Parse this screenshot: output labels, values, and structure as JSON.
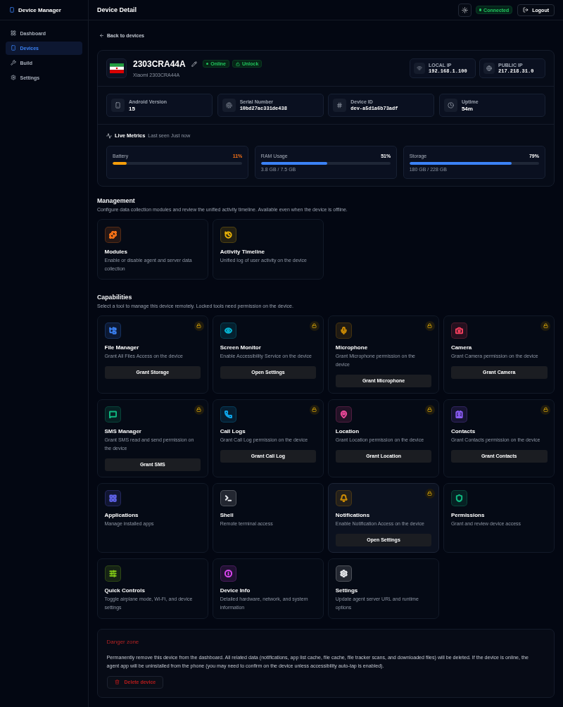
{
  "sidebar": {
    "title": "Device Manager",
    "items": [
      {
        "label": "Dashboard",
        "selected": false
      },
      {
        "label": "Devices",
        "selected": true
      },
      {
        "label": "Build",
        "selected": false
      },
      {
        "label": "Settings",
        "selected": false
      }
    ]
  },
  "header": {
    "title": "Device Detail",
    "status": "Connected",
    "logout": "Logout"
  },
  "back_link": "Back to devices",
  "device": {
    "name": "2303CRA44A",
    "model": "Xiaomi 2303CRA44A",
    "badges": [
      {
        "label": "Online",
        "kind": "dot"
      },
      {
        "label": "Unlock",
        "kind": "lock"
      }
    ],
    "network": [
      {
        "label": "LOCAL IP",
        "value": "192.168.1.100"
      },
      {
        "label": "PUBLIC IP",
        "value": "217.218.31.0"
      }
    ],
    "info": [
      {
        "label": "Android Version",
        "value": "15",
        "kind": "text"
      },
      {
        "label": "Serial Number",
        "value": "10bd27ac331de438",
        "kind": "code"
      },
      {
        "label": "Device ID",
        "value": "dev-a5d1a6b73adf",
        "kind": "code"
      },
      {
        "label": "Uptime",
        "value": "54m",
        "kind": "text"
      }
    ],
    "metrics_title": "Live Metrics",
    "last_seen": "Last seen Just now",
    "metrics": [
      {
        "label": "Battery",
        "reading": "11%",
        "level": 0.11,
        "warning": true
      },
      {
        "label": "RAM Usage",
        "reading": "51%",
        "level": 0.51,
        "detail": "3.8 GB / 7.5 GB",
        "warning": false
      },
      {
        "label": "Storage",
        "reading": "79%",
        "level": 0.79,
        "detail": "180 GB / 228 GB",
        "warning": false
      }
    ]
  },
  "management": {
    "title": "Management",
    "description": "Configure data collection modules and review the unified activity timeline. Available even when the device is offline.",
    "cards": [
      {
        "title": "Modules",
        "description": "Enable or disable agent and server data collection",
        "color": "#f97316"
      },
      {
        "title": "Activity Timeline",
        "description": "Unified log of user activity on the device",
        "color": "#eab308"
      }
    ]
  },
  "capabilities": {
    "title": "Capabilities",
    "description": "Select a tool to manage this device remotely. Locked tools need permission on the device.",
    "cards": [
      {
        "title": "File Manager",
        "description": "Grant All Files Access on the device",
        "action": "Grant Storage",
        "locked": true,
        "highlighted": false,
        "color": "#3b82f6"
      },
      {
        "title": "Screen Monitor",
        "description": "Enable Accessibility Service on the device",
        "action": "Open Settings",
        "locked": true,
        "highlighted": false,
        "color": "#06b6d4"
      },
      {
        "title": "Microphone",
        "description": "Grant Microphone permission on the device",
        "action": "Grant Microphone",
        "locked": true,
        "highlighted": false,
        "color": "#ca8a04"
      },
      {
        "title": "Camera",
        "description": "Grant Camera permission on the device",
        "action": "Grant Camera",
        "locked": true,
        "highlighted": false,
        "color": "#f43f5e"
      },
      {
        "title": "SMS Manager",
        "description": "Grant SMS read and send permission on the device",
        "action": "Grant SMS",
        "locked": true,
        "highlighted": false,
        "color": "#10b981"
      },
      {
        "title": "Call Logs",
        "description": "Grant Call Log permission on the device",
        "action": "Grant Call Log",
        "locked": true,
        "highlighted": false,
        "color": "#0ea5e9"
      },
      {
        "title": "Location",
        "description": "Grant Location permission on the device",
        "action": "Grant Location",
        "locked": true,
        "highlighted": false,
        "color": "#ec4899"
      },
      {
        "title": "Contacts",
        "description": "Grant Contacts permission on the device",
        "action": "Grant Contacts",
        "locked": true,
        "highlighted": false,
        "color": "#8b5cf6"
      },
      {
        "title": "Applications",
        "description": "Manage installed apps",
        "locked": false,
        "highlighted": false,
        "color": "#6366f1"
      },
      {
        "title": "Shell",
        "description": "Remote terminal access",
        "locked": false,
        "highlighted": false,
        "color": "#e5e7eb"
      },
      {
        "title": "Notifications",
        "description": "Enable Notification Access on the device",
        "action": "Open Settings",
        "locked": true,
        "highlighted": true,
        "color": "#ca8a04"
      },
      {
        "title": "Permissions",
        "description": "Grant and review device access",
        "locked": false,
        "highlighted": false,
        "color": "#10b981"
      },
      {
        "title": "Quick Controls",
        "description": "Toggle airplane mode, Wi-Fi, and device settings",
        "locked": false,
        "highlighted": false,
        "color": "#84cc16"
      },
      {
        "title": "Device Info",
        "description": "Detailed hardware, network, and system information",
        "locked": false,
        "highlighted": false,
        "color": "#d946ef"
      },
      {
        "title": "Settings",
        "description": "Update agent server URL and runtime options",
        "locked": false,
        "highlighted": false,
        "color": "#e5e7eb"
      }
    ]
  },
  "danger_zone": {
    "title": "Danger zone",
    "description": "Permanently remove this device from the dashboard. All related data (notifications, app list cache, file cache, file tracker scans, and downloaded files) will be deleted. If the device is online, the agent app will be uninstalled from the phone (you may need to confirm on the device unless accessibility auto-tap is enabled).",
    "button": "Delete device"
  }
}
